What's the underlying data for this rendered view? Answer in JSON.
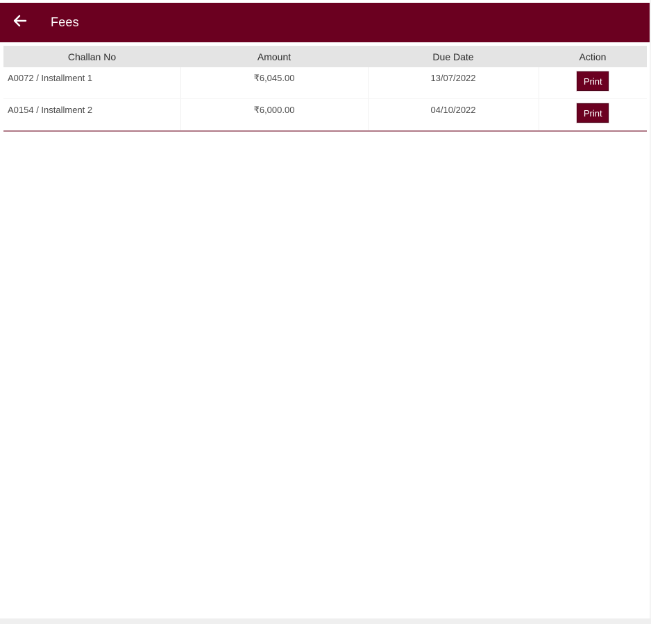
{
  "header": {
    "title": "Fees",
    "back_icon": "arrow-left-icon"
  },
  "table": {
    "columns": [
      "Challan No",
      "Amount",
      "Due Date",
      "Action"
    ],
    "rows": [
      {
        "challan_no": "A0072 / Installment 1",
        "amount": "₹6,045.00",
        "due_date": "13/07/2022",
        "action_label": "Print"
      },
      {
        "challan_no": "A0154 / Installment 2",
        "amount": "₹6,000.00",
        "due_date": "04/10/2022",
        "action_label": "Print"
      }
    ]
  },
  "colors": {
    "brand": "#6b0020",
    "table_header_bg": "#e4e4e4"
  }
}
